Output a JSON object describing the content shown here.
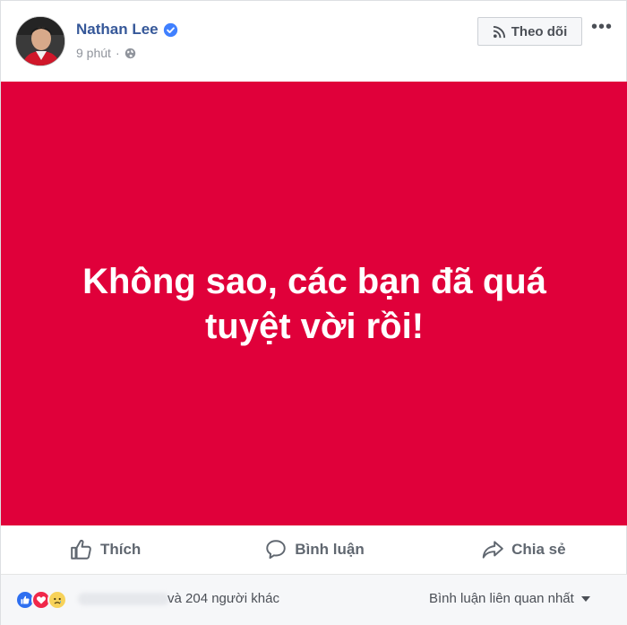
{
  "post": {
    "author": "Nathan Lee",
    "time": "9 phút",
    "separator": "·",
    "follow_label": "Theo dõi",
    "more_label": "•••",
    "status_text": "Không sao, các bạn đã quá tuyệt vời rồi!",
    "banner_color": "#e0003a"
  },
  "actions": {
    "like_label": "Thích",
    "comment_label": "Bình luận",
    "share_label": "Chia sẻ"
  },
  "reactions": {
    "icons": [
      "like-icon",
      "love-icon",
      "sad-icon"
    ],
    "count_text": "và 204 người khác",
    "sort_label": "Bình luận liên quan nhất"
  }
}
